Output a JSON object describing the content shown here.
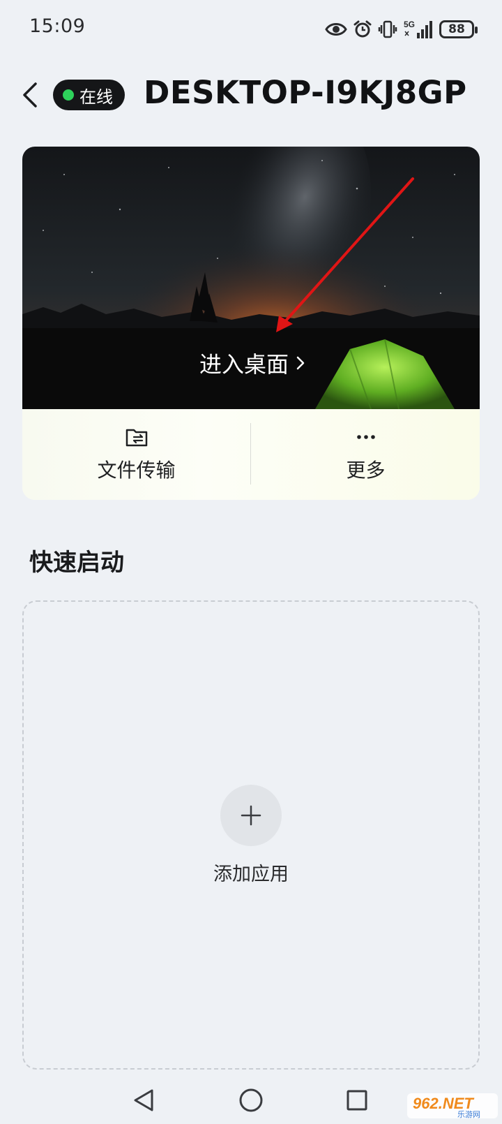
{
  "status_bar": {
    "time": "15:09",
    "network": "5G",
    "battery": "88",
    "icons": [
      "eye-icon",
      "alarm-icon",
      "vibrate-icon",
      "5g-signal-icon",
      "battery-icon"
    ]
  },
  "header": {
    "back_icon": "chevron-left-icon",
    "status_badge": "在线",
    "device_name": "DESKTOP-I9KJ8GP"
  },
  "card": {
    "enter_desktop_label": "进入桌面",
    "enter_icon": "chevron-right-icon",
    "actions": [
      {
        "label": "文件传输",
        "icon": "folder-transfer-icon"
      },
      {
        "label": "更多",
        "icon": "more-dots-icon"
      }
    ]
  },
  "quick_launch": {
    "title": "快速启动",
    "add_label": "添加应用",
    "add_icon": "plus-icon"
  },
  "nav": {
    "icons": [
      "back-triangle-icon",
      "home-circle-icon",
      "recents-square-icon"
    ]
  },
  "watermark": {
    "text_top": "962.NET",
    "text_bottom": "乐游网"
  },
  "colors": {
    "online_dot": "#2ed25b",
    "badge_bg": "#151618",
    "page_bg": "#eef1f5",
    "arrow": "#e01515"
  }
}
